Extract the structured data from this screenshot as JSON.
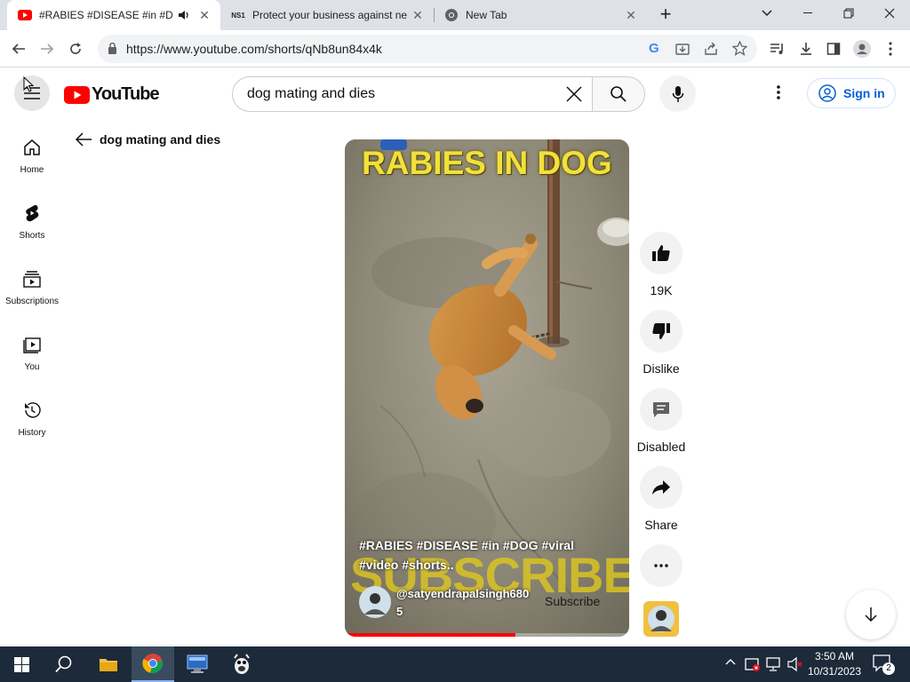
{
  "browser": {
    "tabs": [
      {
        "title": "#RABIES #DISEASE #in #DOG",
        "active": true,
        "favicon": "youtube-favicon-icon"
      },
      {
        "title": "Protect your business against ne",
        "active": false,
        "favicon": "ns1-favicon-icon"
      },
      {
        "title": "New Tab",
        "active": false,
        "favicon": "chrome-favicon-icon"
      }
    ],
    "new_tab": "+",
    "url": "https://www.youtube.com/shorts/qNb8un84x4k"
  },
  "youtube": {
    "logo_text": "YouTube",
    "search": {
      "value": "dog mating and dies"
    },
    "signin_label": "Sign in"
  },
  "sidebar": {
    "items": [
      {
        "label": "Home",
        "icon": "home-icon"
      },
      {
        "label": "Shorts",
        "icon": "shorts-icon"
      },
      {
        "label": "Subscriptions",
        "icon": "subscriptions-icon"
      },
      {
        "label": "You",
        "icon": "you-icon"
      },
      {
        "label": "History",
        "icon": "history-icon"
      }
    ]
  },
  "back_query": "dog mating and dies",
  "video": {
    "overlay_title": "RABIES IN DOG",
    "watermark": "SUBSCRIBE",
    "caption_line1": "#RABIES #DISEASE #in #DOG #viral",
    "caption_line2": "#video #shorts..",
    "channel_line1": "@satyendrapalsingh680",
    "channel_line2": "5",
    "subscribe_label": "Subscribe",
    "progress": 0.6
  },
  "actions": {
    "like_count": "19K",
    "dislike_label": "Dislike",
    "comments_label": "Disabled",
    "share_label": "Share"
  },
  "taskbar": {
    "time": "3:50 AM",
    "date": "10/31/2023",
    "notif_count": "2"
  },
  "colors": {
    "youtube_red": "#ff0000",
    "link_blue": "#065fd4",
    "taskbar_bg": "#1c2a3a",
    "overlay_yellow": "#f3e03a"
  }
}
